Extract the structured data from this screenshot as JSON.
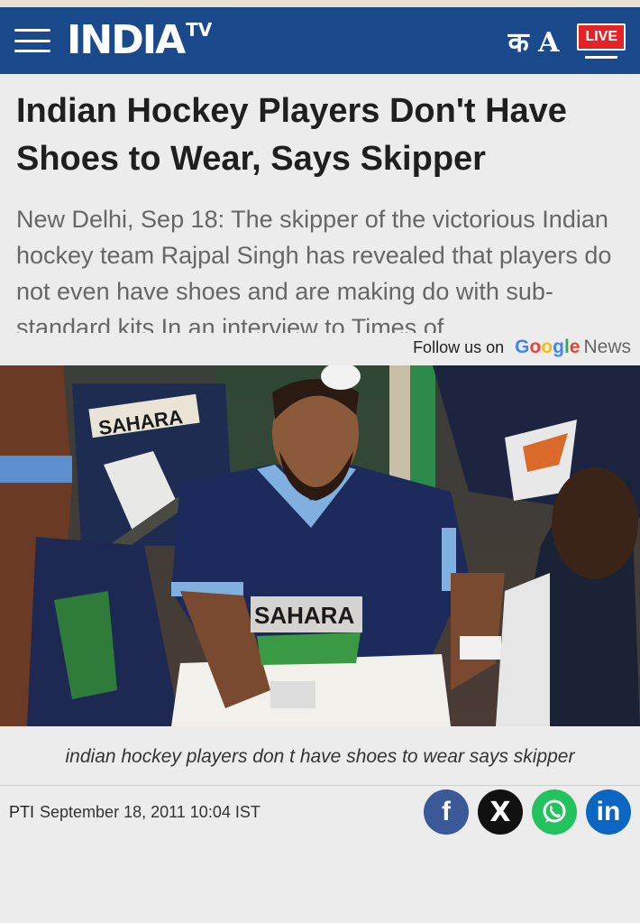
{
  "header": {
    "logo_main": "INDIA",
    "logo_tv": "TV",
    "language_label": "क A",
    "live_label": "LIVE"
  },
  "article": {
    "headline": "Indian Hockey Players Don't Have Shoes to Wear, Says Skipper",
    "summary": "New Delhi, Sep 18: The skipper of the victorious Indian hockey team Rajpal Singh has revealed that players do not even have shoes and are making do with sub-standard kits.In an interview to Times of",
    "follow_label": "Follow us on",
    "google_news": {
      "g1": "G",
      "g2": "o",
      "g3": "o",
      "g4": "g",
      "g5": "l",
      "g6": "e",
      "news": "News"
    },
    "image_text_1": "SAHARA",
    "image_text_2": "SAHARA",
    "image_caption": "indian hockey players don t have shoes to wear says skipper",
    "source": "PTI",
    "date": "September 18, 2011 10:04 IST"
  },
  "social": {
    "facebook": "f",
    "x": "X",
    "whatsapp": "whatsapp-icon",
    "linkedin": "in"
  },
  "colors": {
    "header_bg": "#1b4a8c",
    "live_bg": "#e42326",
    "facebook": "#3b5998",
    "whatsapp": "#22c35e",
    "linkedin": "#0a66c2"
  }
}
